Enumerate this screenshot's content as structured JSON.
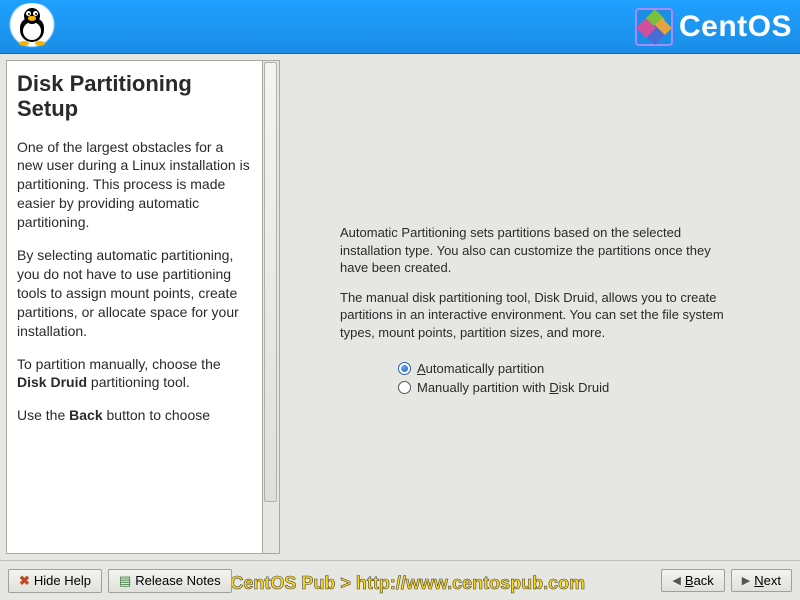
{
  "header": {
    "brand": "CentOS"
  },
  "help": {
    "title": "Disk Partitioning Setup",
    "p1": "One of the largest obstacles for a new user during a Linux installation is partitioning. This process is made easier by providing automatic partitioning.",
    "p2": "By selecting automatic partitioning, you do not have to use partitioning tools to assign mount points, create partitions, or allocate space for your installation.",
    "p3_a": "To partition manually, choose the ",
    "p3_b": "Disk Druid",
    "p3_c": " partitioning tool.",
    "p4_a": "Use the ",
    "p4_b": "Back",
    "p4_c": " button to choose"
  },
  "content": {
    "para1": "Automatic Partitioning sets partitions based on the selected installation type. You also can customize the partitions once they have been created.",
    "para2": "The manual disk partitioning tool, Disk Druid, allows you to create partitions in an interactive environment. You can set the file system types, mount points, partition sizes, and more.",
    "radio1_rest": "utomatically partition",
    "radio2_pre": "Manually partition with ",
    "radio2_rest": "isk Druid"
  },
  "footer": {
    "hide_help": "Hide Help",
    "release_notes": "Release Notes",
    "back": "Back",
    "next": "Next",
    "watermark": "< CentOS Pub >  http://www.centospub.com"
  }
}
